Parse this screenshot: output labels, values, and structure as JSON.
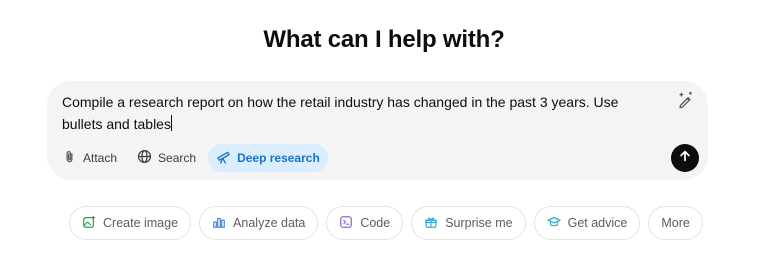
{
  "heading": "What can I help with?",
  "prompt": {
    "text": "Compile a research report on how the retail industry has changed in the past 3 years. Use bullets and tables"
  },
  "toolbar": {
    "attach_label": "Attach",
    "search_label": "Search",
    "deep_research_label": "Deep research"
  },
  "suggestions": [
    {
      "label": "Create image",
      "icon": "image-icon",
      "color": "#2aa05a"
    },
    {
      "label": "Analyze data",
      "icon": "bar-chart-icon",
      "color": "#4b8ad9"
    },
    {
      "label": "Code",
      "icon": "code-icon",
      "color": "#8c68c7"
    },
    {
      "label": "Surprise me",
      "icon": "gift-icon",
      "color": "#3ea7e0"
    },
    {
      "label": "Get advice",
      "icon": "graduation-cap-icon",
      "color": "#39b3c9"
    },
    {
      "label": "More",
      "icon": "",
      "color": ""
    }
  ],
  "colors": {
    "composer_bg": "#f4f4f4",
    "active_tool_bg": "#daeeff",
    "active_tool_text": "#1a73c8",
    "send_button": "#0d0d0d"
  }
}
